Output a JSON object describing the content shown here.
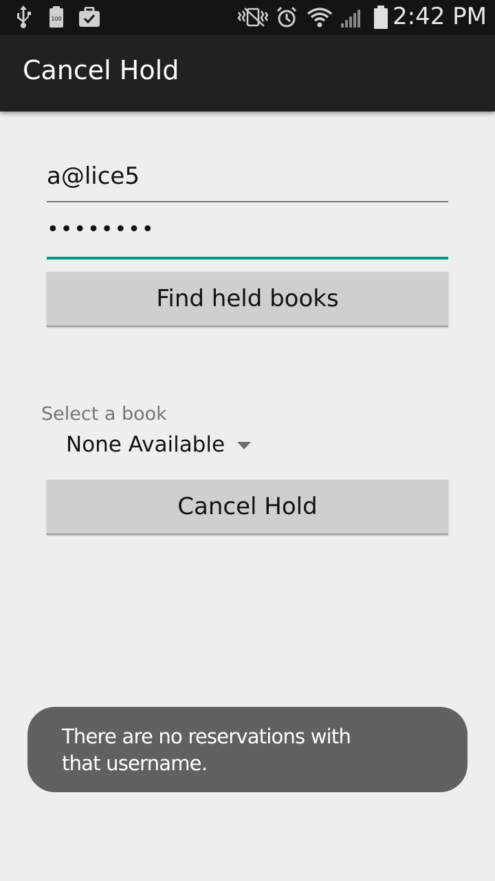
{
  "status_bar": {
    "time": "2:42 PM",
    "battery_label": "100",
    "icons": [
      "usb-icon",
      "battery-saver-icon",
      "briefcase-check-icon",
      "vibrate-icon",
      "alarm-icon",
      "wifi-icon",
      "signal-icon",
      "battery-icon"
    ]
  },
  "app_bar": {
    "title": "Cancel Hold"
  },
  "form": {
    "username_value": "a@lice5",
    "password_value": "••••••••",
    "find_button_label": "Find held books",
    "spinner_label": "Select a book",
    "spinner_value": "None Available",
    "cancel_button_label": "Cancel Hold"
  },
  "toast": {
    "message": "There are no reservations with that username."
  },
  "colors": {
    "accent": "#009688",
    "app_bar": "#212121",
    "status_bar": "#141414",
    "background": "#eeeeee",
    "toast": "#616161"
  }
}
